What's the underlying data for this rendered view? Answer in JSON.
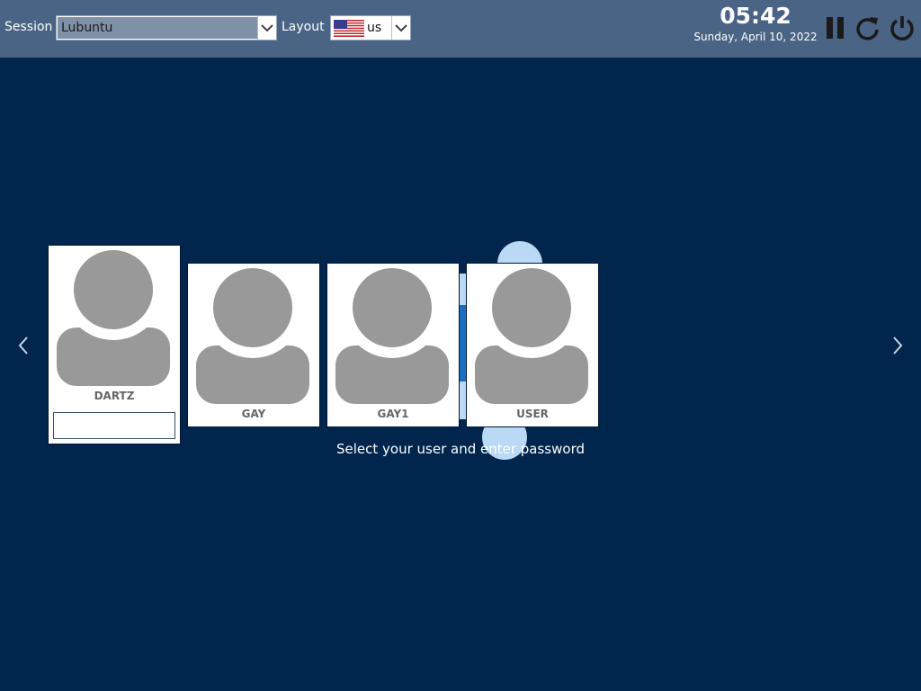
{
  "topbar": {
    "session_label": "Session",
    "session_value": "Lubuntu",
    "layout_label": "Layout",
    "layout_value": "us",
    "layout_flag_icon": "us-flag-icon",
    "time": "05:42",
    "date": "Sunday, April 10, 2022",
    "icons": [
      "suspend-icon",
      "restart-icon",
      "shutdown-icon"
    ]
  },
  "users": [
    {
      "name": "DARTZ",
      "selected": true
    },
    {
      "name": "GAY",
      "selected": false
    },
    {
      "name": "GAY1",
      "selected": false
    },
    {
      "name": "USER",
      "selected": false
    }
  ],
  "password": {
    "value": "",
    "placeholder": ""
  },
  "hint": "Select your user and enter password",
  "colors": {
    "background": "#00264d",
    "topbar": "#4a6485",
    "avatar": "#999999",
    "accent": "#b9d9f4"
  }
}
